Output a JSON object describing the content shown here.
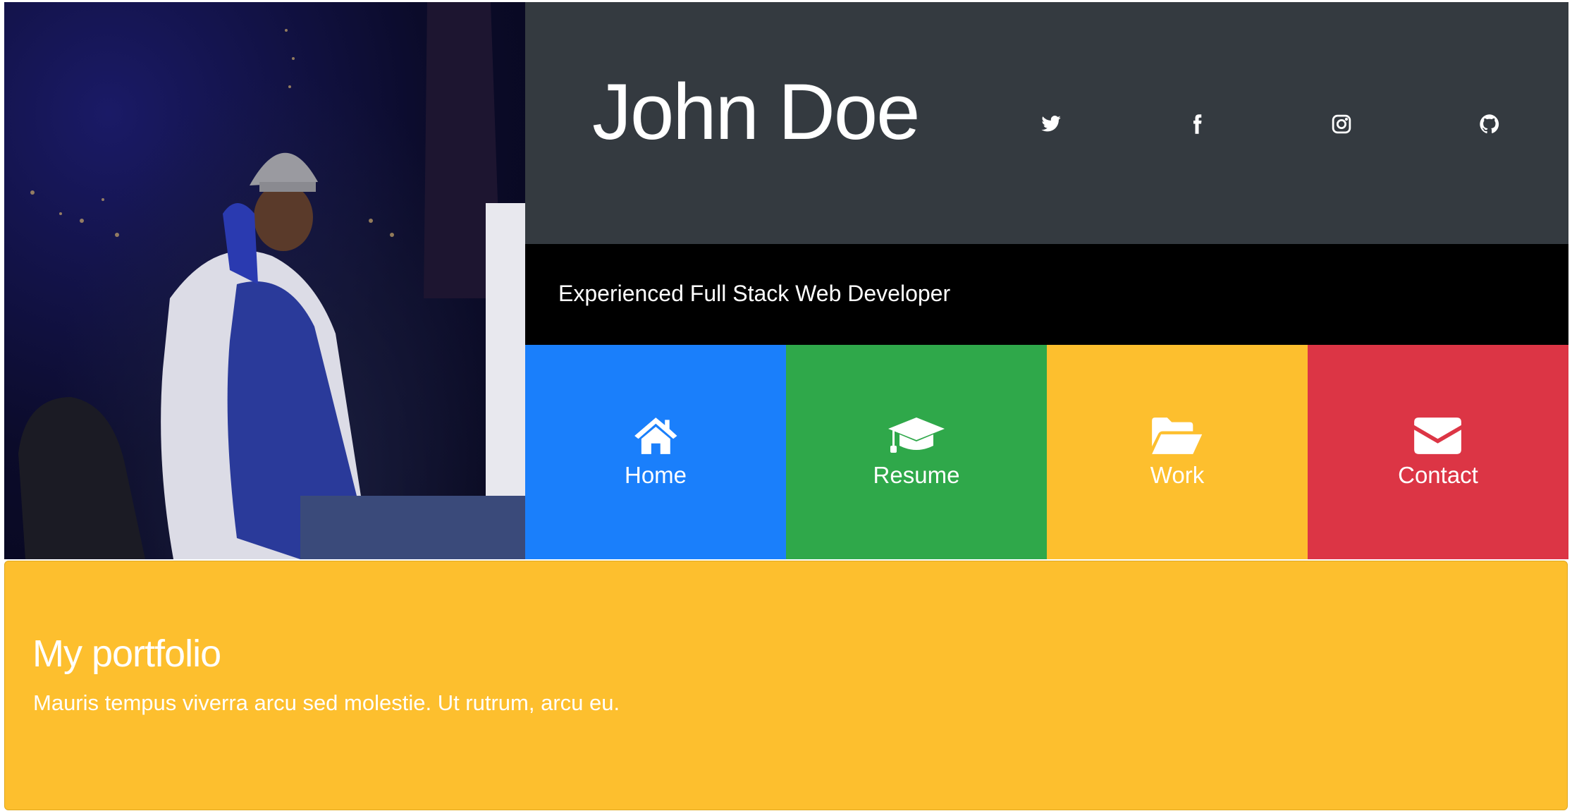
{
  "profile": {
    "name": "John Doe",
    "tagline": "Experienced Full Stack Web Developer"
  },
  "social": [
    {
      "icon": "twitter-icon"
    },
    {
      "icon": "facebook-icon"
    },
    {
      "icon": "instagram-icon"
    },
    {
      "icon": "github-icon"
    }
  ],
  "nav": {
    "home": {
      "label": "Home",
      "icon": "home-icon",
      "color": "#1a7ffb"
    },
    "resume": {
      "label": "Resume",
      "icon": "graduation-cap-icon",
      "color": "#2fa84a"
    },
    "work": {
      "label": "Work",
      "icon": "folder-open-icon",
      "color": "#fdbf2e"
    },
    "contact": {
      "label": "Contact",
      "icon": "envelope-icon",
      "color": "#dc3545"
    }
  },
  "portfolio": {
    "title": "My portfolio",
    "description": "Mauris tempus viverra arcu sed molestie. Ut rutrum, arcu eu."
  },
  "colors": {
    "header_bg": "#343a40",
    "tagline_bg": "#000000",
    "portfolio_bg": "#fdbf2e"
  }
}
